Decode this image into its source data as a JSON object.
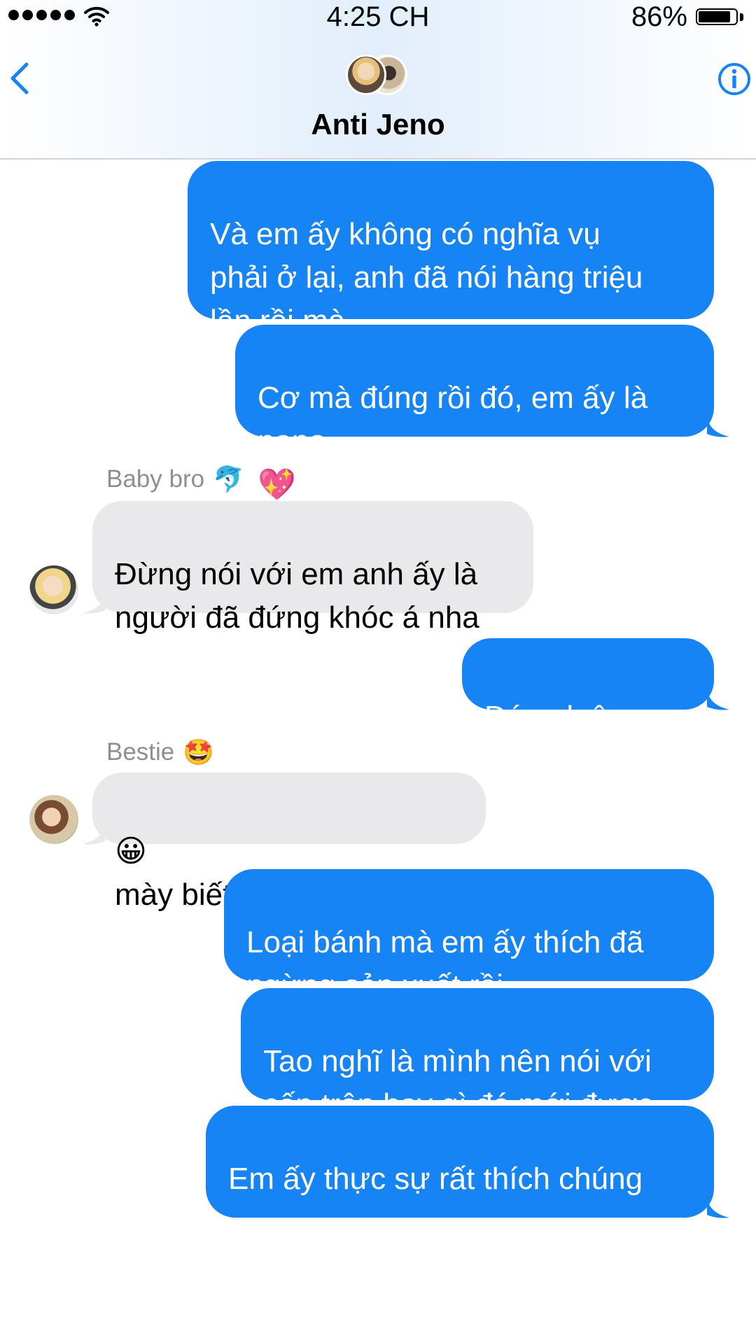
{
  "status": {
    "time": "4:25 CH",
    "battery_pct": "86%",
    "battery_level": 0.86
  },
  "header": {
    "title": "Anti Jeno"
  },
  "colors": {
    "accent": "#1684f5",
    "incoming_bubble": "#e9e9eb",
    "sender_label": "#8e8e93"
  },
  "messages": [
    {
      "direction": "out",
      "text": "Và em ấy không có nghĩa vụ\nphải ở lại, anh đã nói hàng triệu\nlần rồi mà"
    },
    {
      "direction": "out",
      "text": "Cơ mà đúng rồi đó, em ấy là\nnana",
      "emoji": "💖"
    },
    {
      "direction": "in",
      "sender": "Baby bro",
      "sender_emoji": "🐬",
      "text": "Đừng nói với em anh ấy là\nngười đã đứng khóc á nha"
    },
    {
      "direction": "out",
      "text": "Đúng luôn",
      "emoji": "😭"
    },
    {
      "direction": "in",
      "sender": "Bestie",
      "sender_emoji": "🤩",
      "lead_emoji": "😀",
      "text": "mày biết lí do chưa?"
    },
    {
      "direction": "out",
      "text": "Loại bánh mà em ấy thích đã\nngừng sản xuất rồi",
      "emoji": "🥺"
    },
    {
      "direction": "out",
      "text": "Tao nghĩ là mình nên nói với\ncấp trên hay gì đó mới được"
    },
    {
      "direction": "out",
      "text": "Em ấy thực sự rất thích chúng",
      "emoji": "😭",
      "emoji_newline": true
    }
  ]
}
